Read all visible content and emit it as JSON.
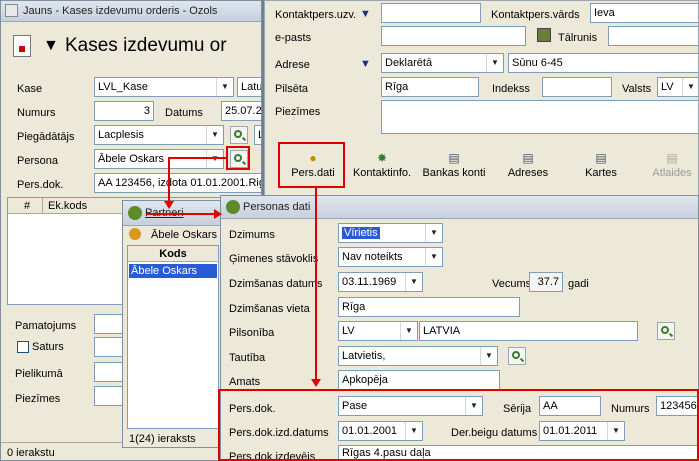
{
  "main_window": {
    "title": "Jauns - Kases izdevumu orderis - Ozols",
    "heading": "Kases izdevumu or",
    "fields": {
      "kase_label": "Kase",
      "kase_value": "LVL_Kase",
      "kase_extra": "Latu",
      "numurs_label": "Numurs",
      "numurs_value": "3",
      "datums_label": "Datums",
      "datums_value": "25.07.20",
      "piegadatajs_label": "Piegādātājs",
      "piegadatajs_value": "Lacplesis",
      "piegadatajs_extra": "L",
      "persona_label": "Persona",
      "persona_value": "Ābele Oskars",
      "persdok_label": "Pers.dok.",
      "persdok_value": "AA 123456, izdota 01.01.2001.Riga"
    },
    "grid": {
      "col_num": "#",
      "col_ekkods": "Ek.kods"
    },
    "bottom": {
      "pamatojums_label": "Pamatojums",
      "saturs_label": "Saturs",
      "pielikuma_label": "Pielikumā",
      "piezimes_label": "Piezīmes"
    },
    "status": "0 ierakstu"
  },
  "partneri_window": {
    "title": "Partneri",
    "search_value": "Ābele Oskars",
    "col_kods": "Kods",
    "rows": [
      "Ābele Oskars"
    ],
    "status": "1(24) ieraksts"
  },
  "contact_panel": {
    "kontaktpers_uzv_label": "Kontaktpers.uzv.",
    "kontaktpers_vards_label": "Kontaktpers.vārds",
    "kontaktpers_vards_value": "Ieva",
    "epasts_label": "e-pasts",
    "talrunis_label": "Tālrunis",
    "adrese_label": "Adrese",
    "adrese_type": "Deklarētā",
    "adrese_value": "Sūnu 6-45",
    "pilseta_label": "Pilsēta",
    "pilseta_value": "Rīga",
    "indekss_label": "Indekss",
    "valsts_label": "Valsts",
    "valsts_value": "LV",
    "piezimes_label": "Piezīmes"
  },
  "toolbar": {
    "buttons": [
      {
        "label": "Pers.dati",
        "icon": "person-icon"
      },
      {
        "label": "Kontaktinfo.",
        "icon": "handshake-icon"
      },
      {
        "label": "Bankas konti",
        "icon": "list-icon"
      },
      {
        "label": "Adreses",
        "icon": "list-icon"
      },
      {
        "label": "Kartes",
        "icon": "cards-icon"
      },
      {
        "label": "Atlaides",
        "icon": "discount-icon"
      }
    ]
  },
  "personas_dati": {
    "title": "Personas dati",
    "dzimums_label": "Dzimums",
    "dzimums_value": "Vīrietis",
    "gimenes_label": "Ģimenes stāvoklis",
    "gimenes_value": "Nav noteikts",
    "dzimsanas_datums_label": "Dzimšanas datums",
    "dzimsanas_datums_value": "03.11.1969",
    "vecums_label": "Vecums",
    "vecums_value": "37.7",
    "vecums_unit": "gadi",
    "dzimsanas_vieta_label": "Dzimšanas vieta",
    "dzimsanas_vieta_value": "Rīga",
    "pilsoniba_label": "Pilsonība",
    "pilsoniba_code": "LV",
    "pilsoniba_name": "LATVIA",
    "tautiba_label": "Tautība",
    "tautiba_value": "Latvietis,",
    "amats_label": "Amats",
    "amats_value": "Apkopēja",
    "persdok_label": "Pers.dok.",
    "persdok_value": "Pase",
    "serija_label": "Sērija",
    "serija_value": "AA",
    "numurs_label": "Numurs",
    "numurs_value": "123456",
    "izd_datums_label": "Pers.dok.izd.datums",
    "izd_datums_value": "01.01.2001",
    "der_beigu_label": "Der.beigu datums",
    "der_beigu_value": "01.01.2011",
    "izdevejs_label": "Pers.dok.izdevējs",
    "izdevejs_value": "Rīgas 4.pasu daļa"
  }
}
